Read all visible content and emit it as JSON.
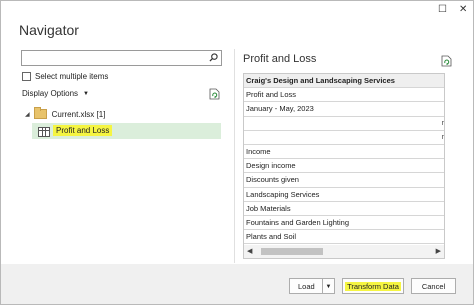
{
  "window": {
    "title": "Navigator",
    "restore_glyph": "☐",
    "close_glyph": "✕"
  },
  "left": {
    "search": {
      "value": "",
      "placeholder": ""
    },
    "select_multiple_label": "Select multiple items",
    "display_options_label": "Display Options",
    "tree": {
      "file_label": "Current.xlsx [1]",
      "selected_item_label": "Profit and Loss"
    }
  },
  "preview": {
    "title": "Profit and Loss",
    "header": "Craig's Design and Landscaping Services",
    "rows": [
      {
        "text": "Profit and Loss",
        "right": ""
      },
      {
        "text": "January - May, 2023",
        "right": ""
      },
      {
        "text": "",
        "right": "r"
      },
      {
        "text": "",
        "right": "r"
      },
      {
        "text": "Income",
        "right": ""
      },
      {
        "text": "Design income",
        "right": ""
      },
      {
        "text": "Discounts given",
        "right": ""
      },
      {
        "text": "Landscaping Services",
        "right": ""
      },
      {
        "text": "Job Materials",
        "right": ""
      },
      {
        "text": "Fountains and Garden Lighting",
        "right": ""
      },
      {
        "text": "Plants and Soil",
        "right": ""
      }
    ]
  },
  "buttons": {
    "load": "Load",
    "transform": "Transform Data",
    "cancel": "Cancel"
  },
  "colors": {
    "highlight": "#f5f542",
    "selection": "#dbeedb"
  }
}
